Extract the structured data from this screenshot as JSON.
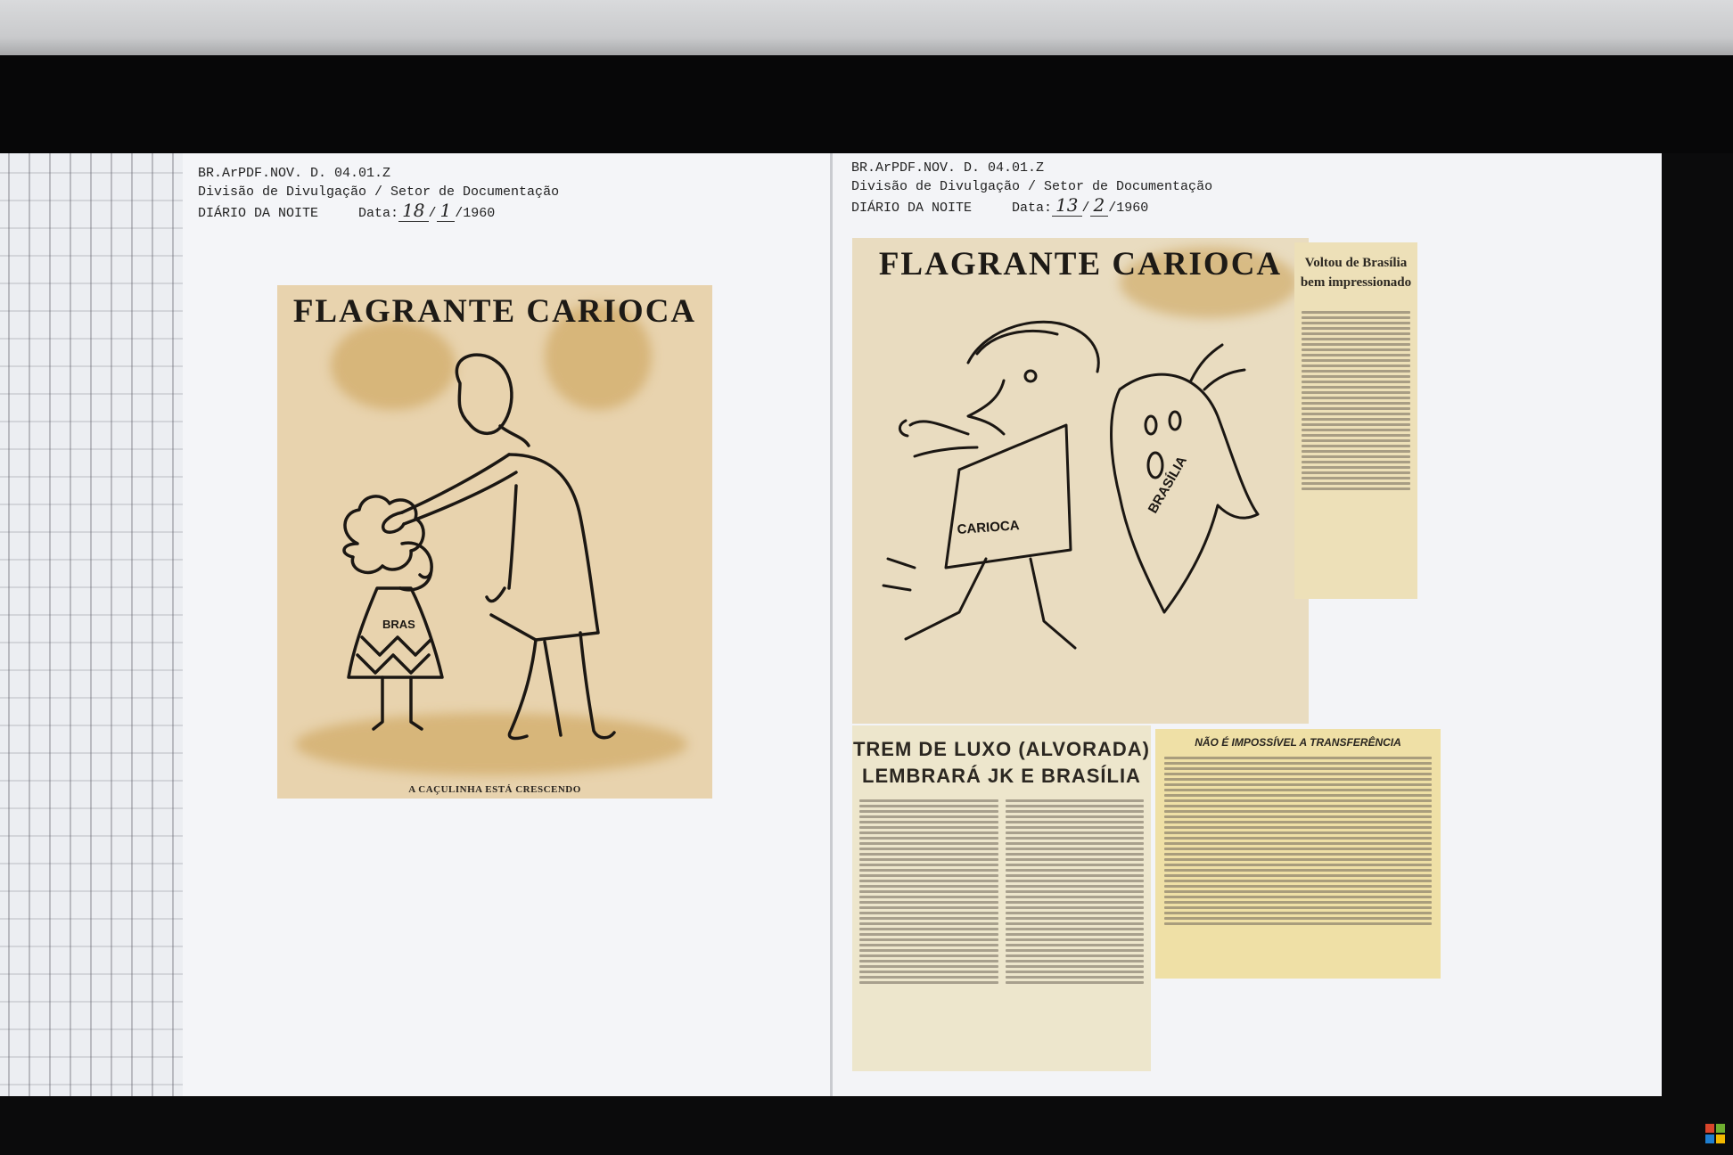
{
  "left_page": {
    "header_line1": "BR.ArPDF.NOV. D. 04.01.Z",
    "header_line2": "Divisão de Divulgação / Setor de Documentação",
    "newspaper": "DIÁRIO DA NOITE",
    "date_label": "Data:",
    "date_day": "18",
    "date_month": "1",
    "date_year": "/1960",
    "clip_title": "FLAGRANTE CARIOCA",
    "cartoon_label": "BRAS",
    "caption": "A CAÇULINHA ESTÁ CRESCENDO"
  },
  "right_page": {
    "header_line1": "BR.ArPDF.NOV. D. 04.01.Z",
    "header_line2": "Divisão de Divulgação / Setor de Documentação",
    "newspaper": "DIÁRIO DA NOITE",
    "date_label": "Data:",
    "date_day": "13",
    "date_month": "2",
    "date_year": "/1960",
    "clip_title": "FLAGRANTE CARIOCA",
    "cartoon_label_left": "CARIOCA",
    "cartoon_label_right": "BRASÍLIA",
    "article1_title_a": "Voltou de Brasília",
    "article1_title_b": "bem impressionado",
    "article2_title_a": "TREM DE LUXO (ALVORADA)",
    "article2_title_b": "LEMBRARÁ JK E BRASÍLIA",
    "article3_title": "NÃO É IMPOSSÍVEL A TRANSFERÊNCIA"
  },
  "colors": {
    "newsprint": "#e8d3ae",
    "ink": "#1d1a16",
    "screen": "#e9ebf0"
  }
}
